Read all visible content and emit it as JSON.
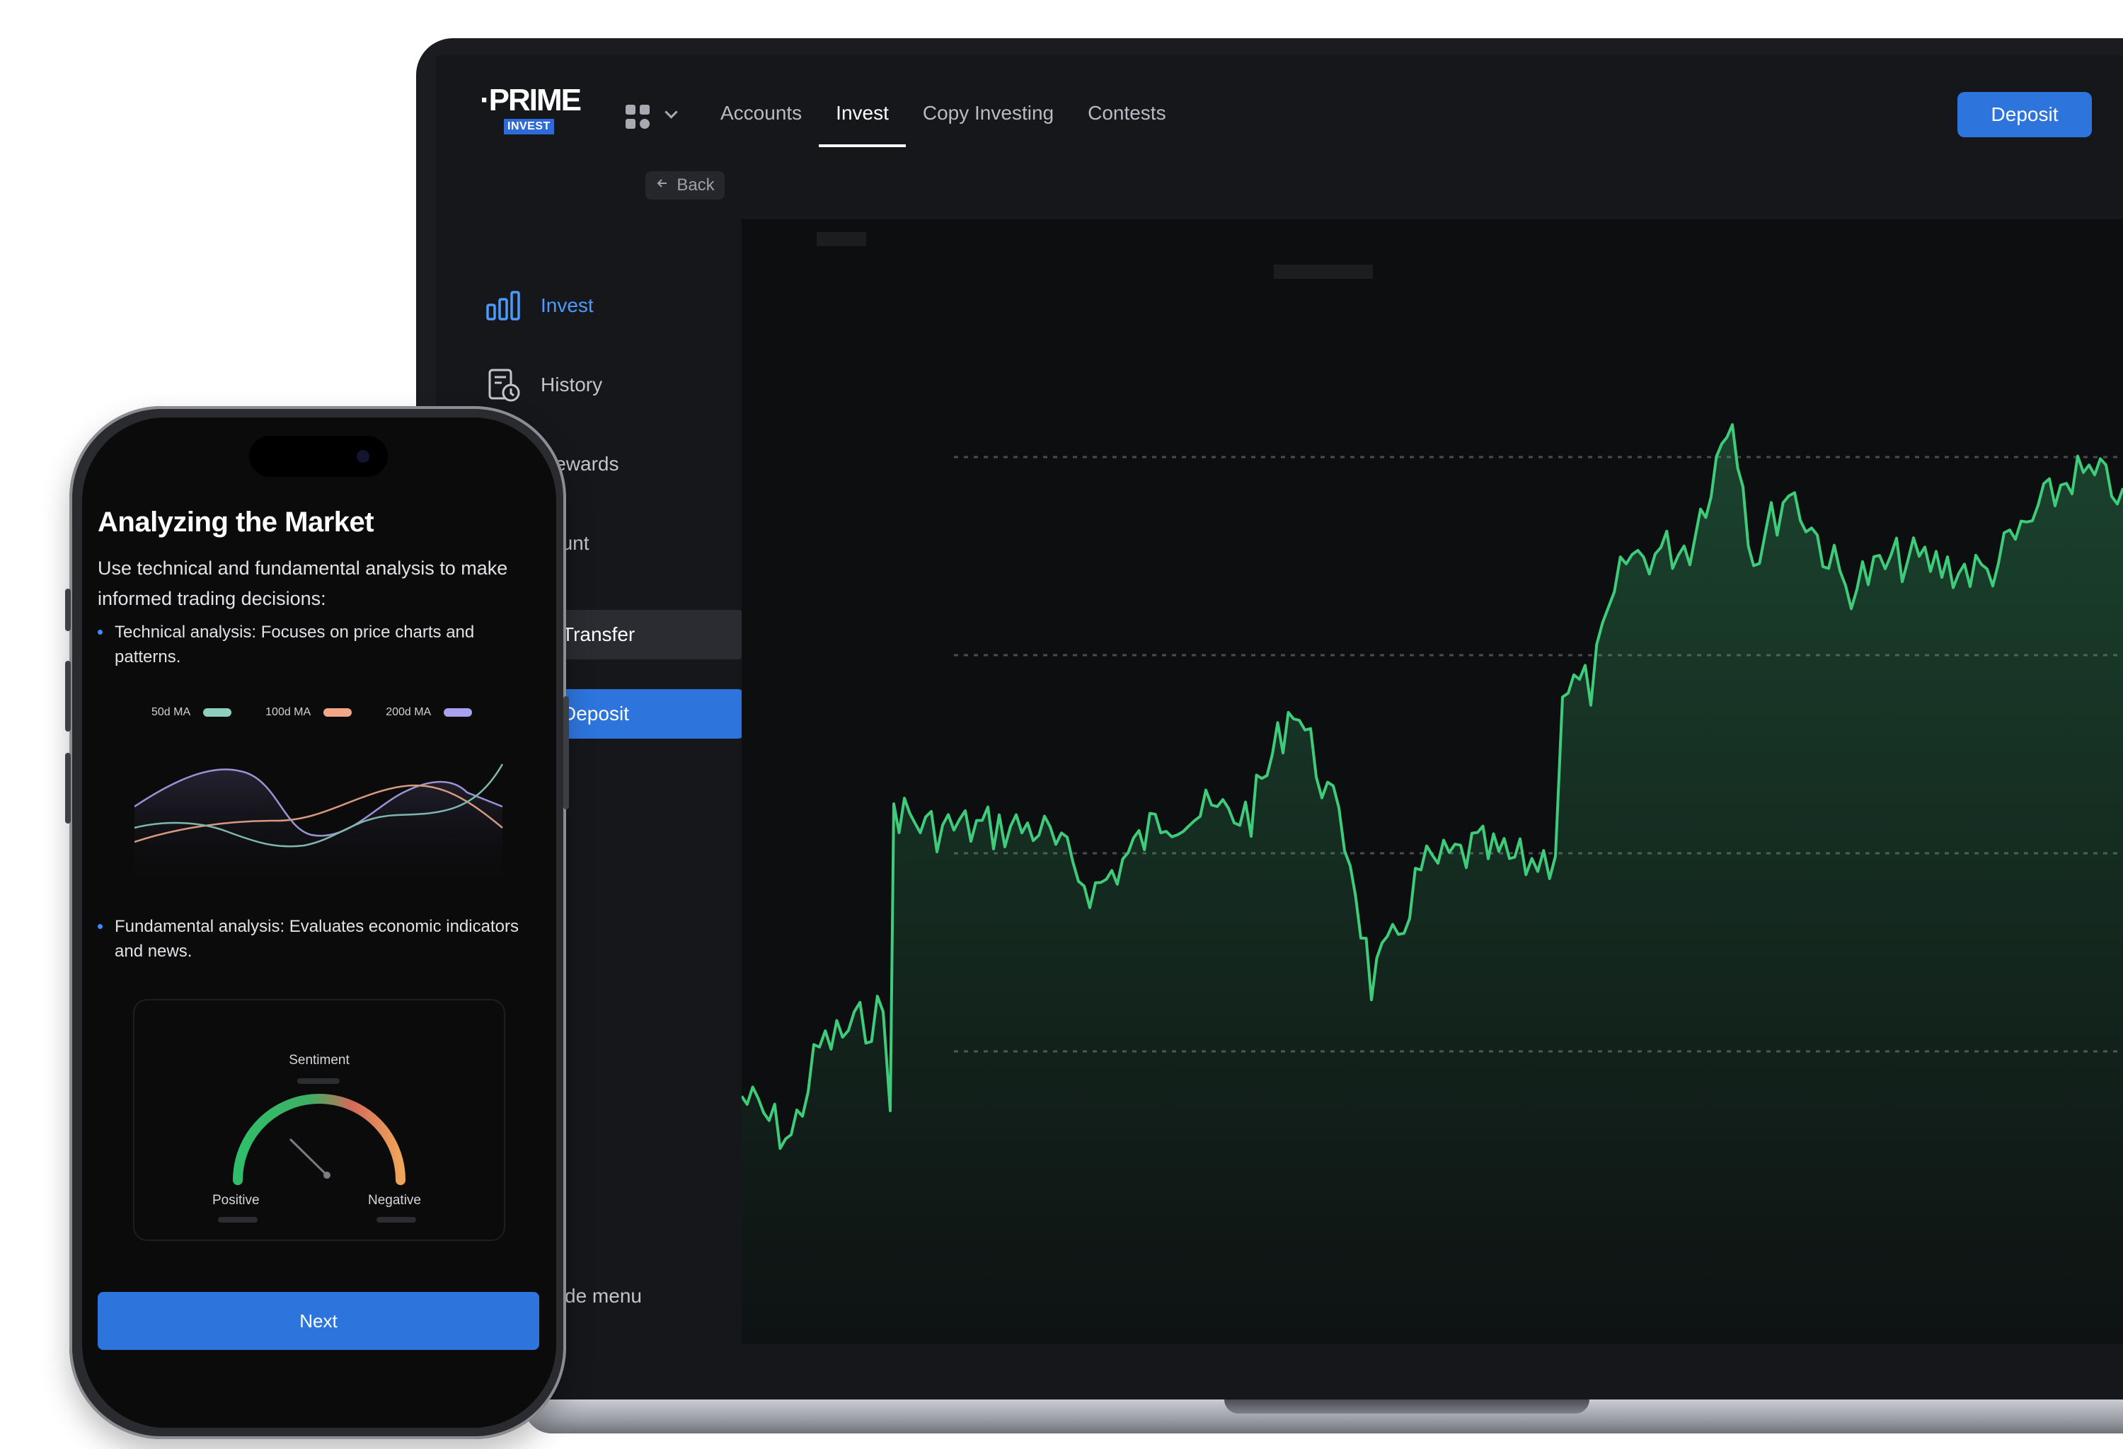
{
  "app": {
    "logo": "·PRIME",
    "logo_badge": "INVEST"
  },
  "nav": {
    "tabs": [
      "Accounts",
      "Invest",
      "Copy Investing",
      "Contests"
    ],
    "active_tab": "Invest",
    "deposit_label": "Deposit"
  },
  "back_label": "Back",
  "sidebar": {
    "items": [
      {
        "label": "Invest",
        "icon": "bar-chart-icon",
        "active": true
      },
      {
        "label": "History",
        "icon": "history-receipt-icon"
      },
      {
        "label": "Rewards",
        "icon": "gift-icon"
      },
      {
        "label": "count",
        "icon": "account-icon"
      }
    ],
    "transfer_label": "Transfer",
    "deposit_label": "Deposit",
    "footer_label": "de menu"
  },
  "price_chart": {
    "type": "area",
    "line_color": "#3ecb7a",
    "gridlines": 4
  },
  "phone": {
    "title": "Analyzing the Market",
    "subtitle": "Use technical and fundamental analysis to make informed trading decisions:",
    "bullets": [
      "Technical analysis: Focuses on price charts and patterns.",
      "Fundamental analysis: Evaluates economic indicators and news."
    ],
    "ma_legend": [
      {
        "label": "50d MA",
        "color": "#8fcfc0"
      },
      {
        "label": "100d MA",
        "color": "#f2a888"
      },
      {
        "label": "200d MA",
        "color": "#a9a2f0"
      }
    ],
    "sentiment": {
      "title": "Sentiment",
      "positive_label": "Positive",
      "negative_label": "Negative"
    },
    "next_label": "Next"
  },
  "colors": {
    "accent": "#2d75dc",
    "active_link": "#4a9bff"
  }
}
